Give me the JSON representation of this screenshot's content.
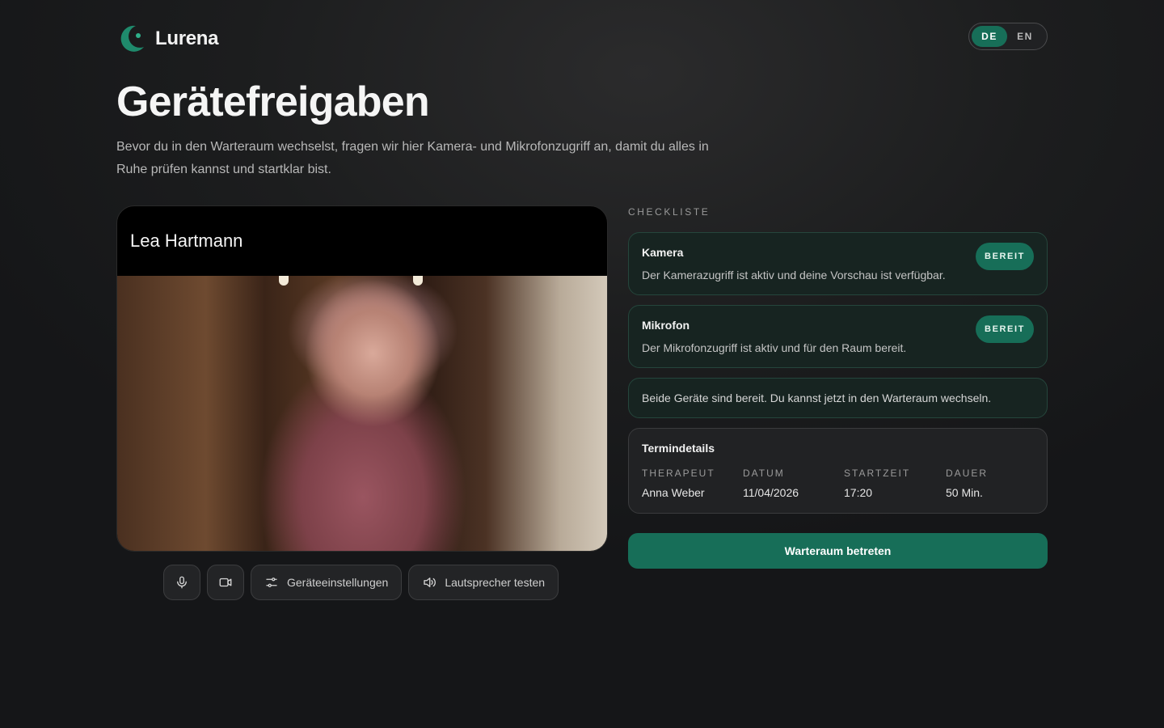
{
  "brand": {
    "name": "Lurena",
    "icon": "lurena-logo-icon"
  },
  "language": {
    "options": [
      "DE",
      "EN"
    ],
    "selected": "DE"
  },
  "page": {
    "title": "Gerätefreigaben",
    "intro": "Bevor du in den Warteraum wechselst, fragen wir hier Kamera- und Mikrofonzugriff an, damit du alles in Ruhe prüfen kannst und startklar bist."
  },
  "video": {
    "participant_name": "Lea Hartmann"
  },
  "controls": {
    "mic_icon": "microphone-icon",
    "camera_icon": "video-camera-icon",
    "device_settings_label": "Geräteeinstellungen",
    "speaker_test_label": "Lautsprecher testen"
  },
  "checklist": {
    "label": "CHECKLISTE",
    "items": [
      {
        "title": "Kamera",
        "description": "Der Kamerazugriff ist aktiv und deine Vorschau ist verfügbar.",
        "status": "BEREIT"
      },
      {
        "title": "Mikrofon",
        "description": "Der Mikrofonzugriff ist aktiv und für den Raum bereit.",
        "status": "BEREIT"
      }
    ],
    "ready_message": "Beide Geräte sind bereit. Du kannst jetzt in den Warteraum wechseln."
  },
  "appointment": {
    "title": "Termindetails",
    "fields": [
      {
        "label": "THERAPEUT",
        "value": "Anna Weber"
      },
      {
        "label": "DATUM",
        "value": "11/04/2026"
      },
      {
        "label": "STARTZEIT",
        "value": "17:20"
      },
      {
        "label": "DAUER",
        "value": "50 Min."
      }
    ]
  },
  "cta": {
    "label": "Warteraum betreten"
  },
  "colors": {
    "accent": "#176e58",
    "card_bg": "#172421",
    "card_border": "#25463c",
    "background": "#1c1d1e"
  }
}
